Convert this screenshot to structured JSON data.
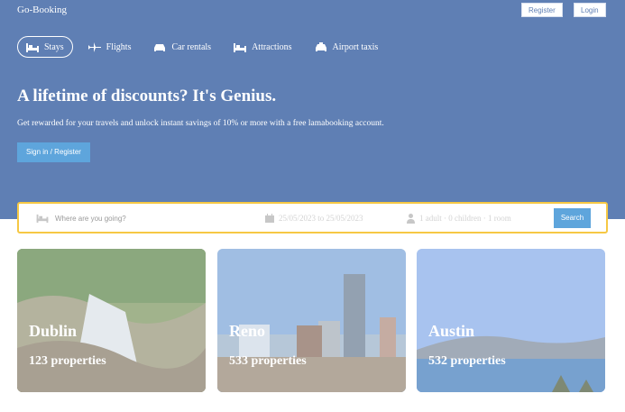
{
  "brand": "Go-Booking",
  "header": {
    "register_label": "Register",
    "login_label": "Login"
  },
  "nav": {
    "items": [
      {
        "label": "Stays",
        "icon": "bed-icon",
        "active": true
      },
      {
        "label": "Flights",
        "icon": "plane-icon"
      },
      {
        "label": "Car rentals",
        "icon": "car-icon"
      },
      {
        "label": "Attractions",
        "icon": "bed-icon"
      },
      {
        "label": "Airport taxis",
        "icon": "taxi-icon"
      }
    ]
  },
  "hero": {
    "headline": "A lifetime of discounts? It's Genius.",
    "subline": "Get rewarded for your travels and unlock instant savings of 10% or more with a free lamabooking account.",
    "cta_label": "Sign in / Register"
  },
  "search": {
    "destination_placeholder": "Where are you going?",
    "dates": "25/05/2023 to 25/05/2023",
    "guests": "1 adult · 0 children · 1 room",
    "button_label": "Search"
  },
  "featured": [
    {
      "city": "Dublin",
      "properties": "123 properties"
    },
    {
      "city": "Reno",
      "properties": "533 properties"
    },
    {
      "city": "Austin",
      "properties": "532 properties"
    }
  ],
  "colors": {
    "hero_bg": "#5f7fb4",
    "accent": "#5ea5dc",
    "search_border": "#f6c844"
  }
}
